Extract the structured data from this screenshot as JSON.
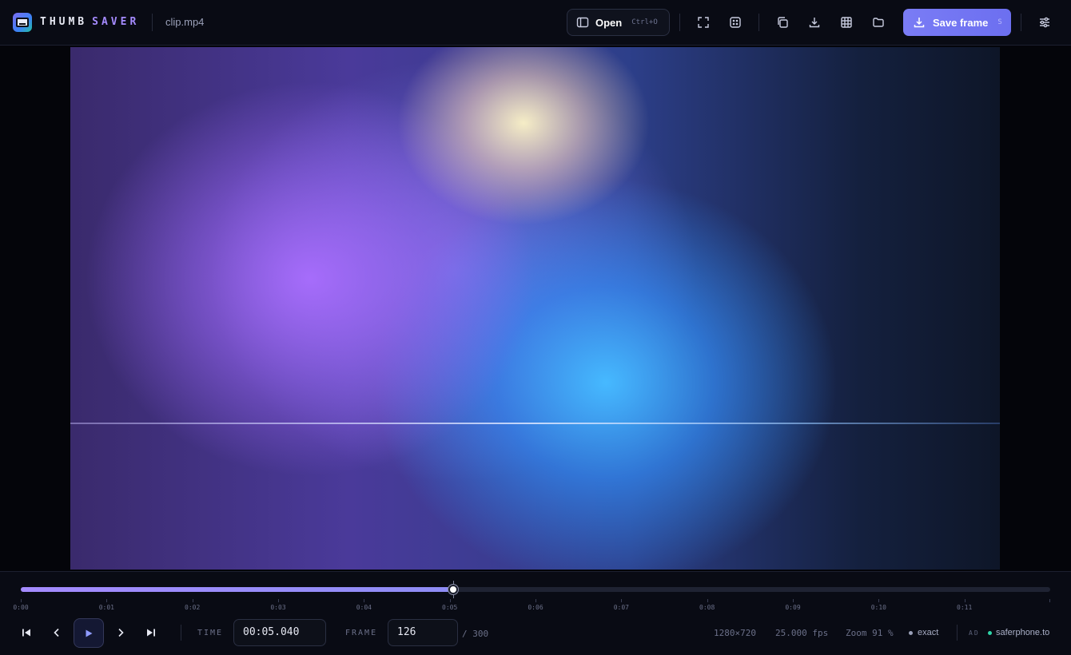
{
  "app": {
    "brand_part1": "THUMB",
    "brand_part2": "SAVER",
    "filename": "clip.mp4"
  },
  "toolbar": {
    "open_label": "Open",
    "open_shortcut": "Ctrl+O",
    "save_label": "Save frame",
    "save_shortcut": "S",
    "icons": [
      "panel-icon",
      "fullscreen-icon",
      "grid-dots-icon",
      "copy-icon",
      "download-icon",
      "table-icon",
      "folder-icon",
      "sliders-icon"
    ]
  },
  "timeline": {
    "progress": 0.42,
    "ticks": [
      "0:00",
      "0:01",
      "0:02",
      "0:03",
      "0:04",
      "0:05",
      "0:06",
      "0:07",
      "0:08",
      "0:09",
      "0:10",
      "0:11"
    ],
    "duration_seconds": 12
  },
  "controls": {
    "time_label": "TIME",
    "time_value": "00:05.040",
    "frame_label": "FRAME",
    "frame_value": "126",
    "frame_total": "/ 300"
  },
  "status": {
    "resolution": "1280×720",
    "fps": "25.000 fps",
    "zoom": "Zoom 91 %",
    "mode": "exact",
    "ad_label": "AD",
    "ad_link": "saferphone.to"
  },
  "colors": {
    "accent": "#7a7cf5",
    "progress": "#a48bff",
    "ad_dot": "#2fd5a8"
  }
}
